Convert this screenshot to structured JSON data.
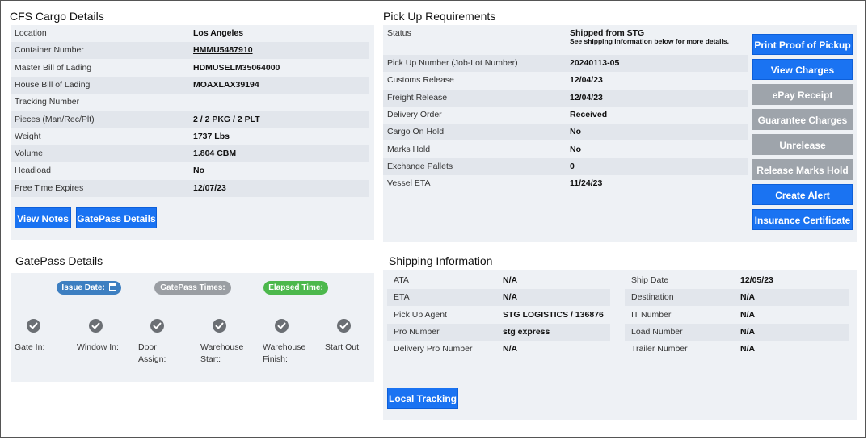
{
  "cfs": {
    "title": "CFS Cargo Details",
    "rows": [
      {
        "label": "Location",
        "value": "Los Angeles"
      },
      {
        "label": "Container Number",
        "value": "HMMU5487910"
      },
      {
        "label": "Master Bill of Lading",
        "value": "HDMUSELM35064000"
      },
      {
        "label": "House Bill of Lading",
        "value": "MOAXLAX39194"
      },
      {
        "label": "Tracking Number",
        "value": ""
      },
      {
        "label": "Pieces (Man/Rec/Plt)",
        "value": "2 / 2 PKG / 2 PLT"
      },
      {
        "label": "Weight",
        "value": "1737 Lbs"
      },
      {
        "label": "Volume",
        "value": "1.804 CBM"
      },
      {
        "label": "Headload",
        "value": "No"
      },
      {
        "label": "Free Time Expires",
        "value": "12/07/23"
      }
    ],
    "buttons": {
      "view_notes": "View Notes",
      "gatepass_details": "GatePass Details"
    }
  },
  "pickup": {
    "title": "Pick Up Requirements",
    "status_label": "Status",
    "status_value": "Shipped from STG",
    "status_note": "See shipping information below for more details.",
    "rows": [
      {
        "label": "Pick Up Number (Job-Lot Number)",
        "value": "20240113-05"
      },
      {
        "label": "Customs Release",
        "value": "12/04/23"
      },
      {
        "label": "Freight Release",
        "value": "12/04/23"
      },
      {
        "label": "Delivery Order",
        "value": "Received"
      },
      {
        "label": "Cargo On Hold",
        "value": "No"
      },
      {
        "label": "Marks Hold",
        "value": "No"
      },
      {
        "label": "Exchange Pallets",
        "value": "0"
      },
      {
        "label": "Vessel ETA",
        "value": "11/24/23"
      }
    ],
    "buttons": [
      {
        "label": "Print Proof of Pickup",
        "enabled": true
      },
      {
        "label": "View Charges",
        "enabled": true
      },
      {
        "label": "ePay Receipt",
        "enabled": false
      },
      {
        "label": "Guarantee Charges",
        "enabled": false
      },
      {
        "label": "Unrelease",
        "enabled": false
      },
      {
        "label": "Release Marks Hold",
        "enabled": false
      },
      {
        "label": "Create Alert",
        "enabled": true
      },
      {
        "label": "Insurance Certificate",
        "enabled": true
      }
    ]
  },
  "gatepass": {
    "title": "GatePass Details",
    "pills": {
      "issue_date": "Issue Date:",
      "gatepass_times": "GatePass Times:",
      "elapsed_time": "Elapsed Time:"
    },
    "steps": [
      "Gate In:",
      "Window In:",
      "Door Assign:",
      "Warehouse Start:",
      "Warehouse Finish:",
      "Start Out:"
    ],
    "colors": {
      "issue": "#3d7fc1",
      "times": "#9a9ea3",
      "elapsed": "#4cb84c"
    }
  },
  "shipping": {
    "title": "Shipping Information",
    "left": [
      {
        "label": "ATA",
        "value": "N/A"
      },
      {
        "label": "ETA",
        "value": "N/A"
      },
      {
        "label": "Pick Up Agent",
        "value": "STG LOGISTICS / 136876"
      },
      {
        "label": "Pro Number",
        "value": "stg express"
      },
      {
        "label": "Delivery Pro Number",
        "value": "N/A"
      }
    ],
    "right": [
      {
        "label": "Ship Date",
        "value": "12/05/23"
      },
      {
        "label": "Destination",
        "value": "N/A"
      },
      {
        "label": "IT Number",
        "value": "N/A"
      },
      {
        "label": "Load Number",
        "value": "N/A"
      },
      {
        "label": "Trailer Number",
        "value": "N/A"
      }
    ],
    "local_tracking": "Local Tracking"
  }
}
